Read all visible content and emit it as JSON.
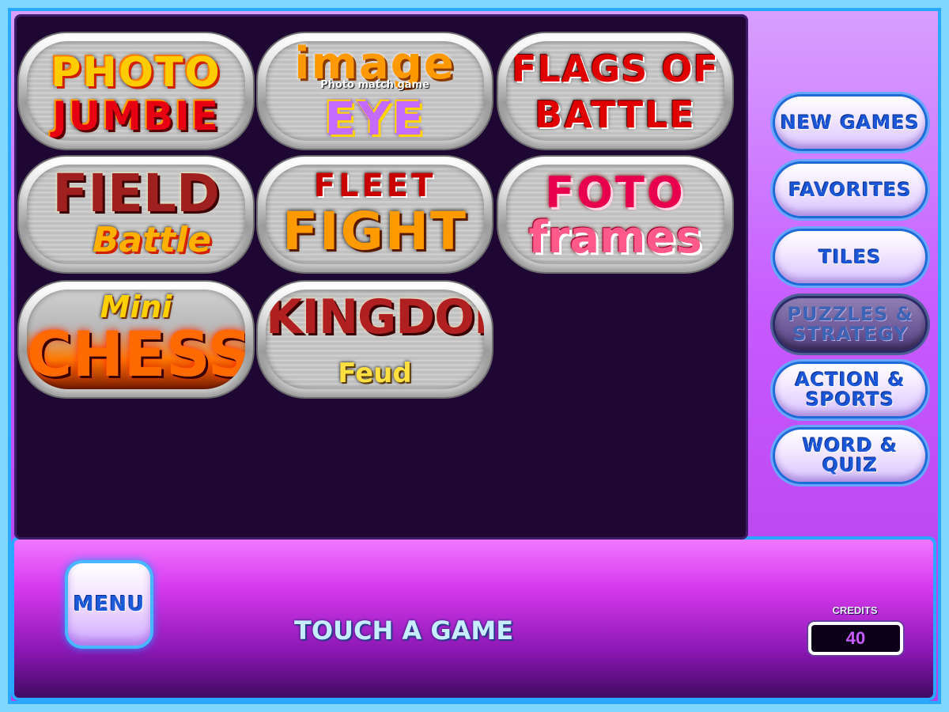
{
  "games": [
    {
      "line1": "PHOTO",
      "line2": "JUMBIE"
    },
    {
      "line1": "image",
      "sub": "Photo match game",
      "line2": "EYE"
    },
    {
      "line1": "FLAGS OF",
      "line2": "BATTLE"
    },
    {
      "line1": "FIELD",
      "line2": "Battle"
    },
    {
      "line1": "FLEET",
      "line2": "FIGHT"
    },
    {
      "line1": "FOTO",
      "line2": "frames"
    },
    {
      "line1": "Mini",
      "line2": "CHESS"
    },
    {
      "line1": "KINGDOM",
      "line2": "Feud"
    }
  ],
  "categories": {
    "new_games": "NEW GAMES",
    "favorites": "FAVORITES",
    "tiles": "TILES",
    "puzzles": "PUZZLES &\nSTRATEGY",
    "action": "ACTION &\nSPORTS",
    "word": "WORD &\nQUIZ"
  },
  "menu_label": "MENU",
  "prompt": "TOUCH A GAME",
  "credits": {
    "label": "CREDITS",
    "value": "40"
  },
  "colors": {
    "frame": "#7fd6ff",
    "panel": "#1e0833",
    "accent": "#c659ff",
    "button_text": "#1a56d6"
  }
}
